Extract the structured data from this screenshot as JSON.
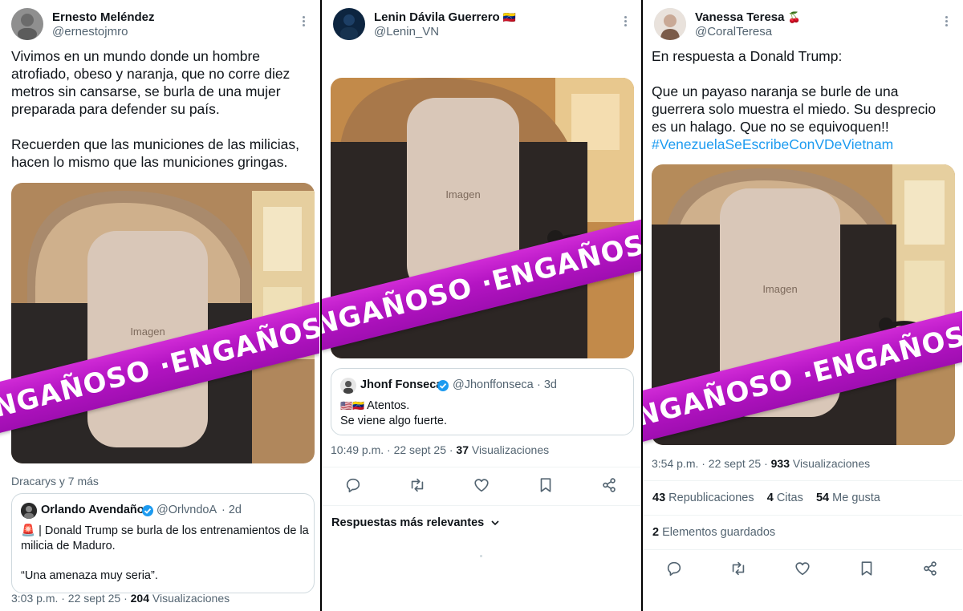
{
  "colors": {
    "stamp": "#b414c3",
    "stamp_text": "#ffffff",
    "link": "#1d9bf0",
    "secondary_text": "#536471"
  },
  "panels": [
    {
      "author": {
        "name": "Ernesto Meléndez",
        "handle": "@ernestojmro"
      },
      "text": [
        "Vivimos en un mundo donde un hombre atrofiado, obeso y naranja, que no corre diez metros sin cansarse, se burla de una mujer preparada para defender su país.",
        "Recuerden que las municiones de las milicias, hacen lo mismo que las municiones gringas."
      ],
      "stamp": "ENGAÑOSO ·ENGAÑOSO",
      "media_label": "Imagen",
      "tagged": "Dracarys y 7 más",
      "quote": {
        "name": "Orlando Avendaño",
        "handle": "@OrlvndoA",
        "age": "· 2d",
        "emoji": "🚨",
        "line1": "| Donald Trump se burla de los entrenamientos de la",
        "line2": "milicia de Maduro.",
        "line3": "“Una amenaza muy seria”."
      },
      "timestamp": "3:03 p.m. · 22 sept 25 ·",
      "views_count": "204",
      "views_label": "Visualizaciones"
    },
    {
      "author": {
        "name": "Lenin Dávila Guerrero",
        "handle": "@Lenin_VN",
        "flag": "🇻🇪"
      },
      "stamp": "ENGAÑOSO ·ENGAÑOSO",
      "media_label": "Imagen",
      "quote": {
        "name": "Jhonf Fonseca",
        "handle": "@Jhonffonseca",
        "age": "· 3d",
        "flags": "🇺🇸🇻🇪",
        "line1": "Atentos.",
        "line2": "Se viene algo fuerte."
      },
      "timestamp": "10:49 p.m. · 22 sept 25 ·",
      "views_count": "37",
      "views_label": "Visualizaciones",
      "icons": [
        "reply-icon",
        "retweet-icon",
        "like-icon",
        "bookmark-icon",
        "share-icon"
      ],
      "replies_sort": "Respuestas más relevantes"
    },
    {
      "author": {
        "name": "Vanessa Teresa",
        "handle": "@CoralTeresa",
        "emoji": "🍒"
      },
      "text": [
        "En respuesta a Donald Trump:",
        "Que un payaso naranja se burle de una guerrera solo muestra el miedo. Su desprecio es un halago. Que no se equivoquen!!"
      ],
      "hashtag": "#VenezuelaSeEscribeConVDeVietnam",
      "stamp": "ENGAÑOSO ·ENGAÑOSO",
      "media_label": "Imagen",
      "timestamp": "3:54 p.m. · 22 sept 25 ·",
      "views_count": "933",
      "views_label": "Visualizaciones",
      "reposts_count": "43",
      "reposts_label": "Republicaciones",
      "quotes_count": "4",
      "quotes_label": "Citas",
      "likes_count": "54",
      "likes_label": "Me gusta",
      "saved_count": "2",
      "saved_label": "Elementos guardados",
      "icons": [
        "reply-icon",
        "retweet-icon",
        "like-icon",
        "bookmark-icon",
        "share-icon"
      ]
    }
  ]
}
